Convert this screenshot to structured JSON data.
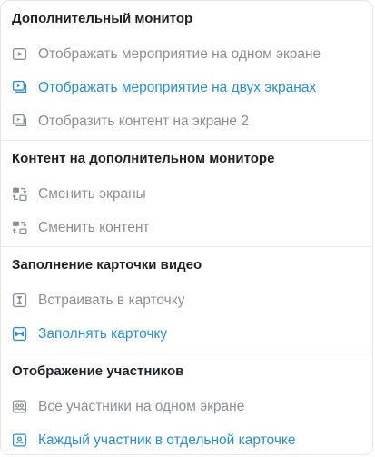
{
  "colors": {
    "active": "#2a8fd1",
    "inactive": "#8b9096",
    "title": "#1f2329"
  },
  "sections": [
    {
      "title": "Дополнительный монитор",
      "items": [
        {
          "label": "Отображать мероприятие на одном экране",
          "icon": "single-screen-icon",
          "active": false
        },
        {
          "label": "Отображать мероприятие на двух экранах",
          "icon": "dual-screen-icon",
          "active": true
        },
        {
          "label": "Отобразить контент на экране 2",
          "icon": "content-screen-2-icon",
          "active": false
        }
      ]
    },
    {
      "title": "Контент на дополнительном мониторе",
      "items": [
        {
          "label": "Сменить экраны",
          "icon": "swap-screens-icon",
          "active": false
        },
        {
          "label": "Сменить контент",
          "icon": "swap-content-icon",
          "active": false
        }
      ]
    },
    {
      "title": "Заполнение карточки видео",
      "items": [
        {
          "label": "Встраивать в карточку",
          "icon": "fit-card-icon",
          "active": false
        },
        {
          "label": "Заполнять карточку",
          "icon": "fill-card-icon",
          "active": true
        }
      ]
    },
    {
      "title": "Отображение участников",
      "items": [
        {
          "label": "Все участники на одном экране",
          "icon": "all-participants-icon",
          "active": false
        },
        {
          "label": "Каждый участник в отдельной карточке",
          "icon": "participant-card-icon",
          "active": true
        }
      ]
    }
  ]
}
